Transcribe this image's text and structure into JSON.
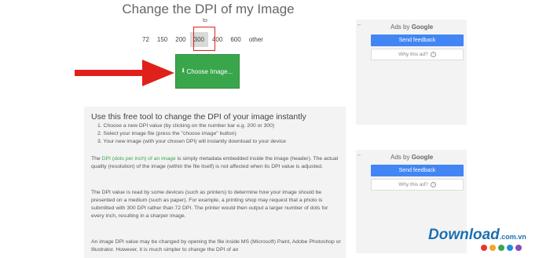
{
  "page": {
    "title": "Change the DPI of my Image",
    "to_label": "to"
  },
  "dpi_options": [
    "72",
    "150",
    "200",
    "300",
    "400",
    "600",
    "other"
  ],
  "selected_dpi": "300",
  "choose_button": {
    "label": "Choose Image..."
  },
  "content": {
    "heading": "Use this free tool to change the DPI of your image instantly",
    "steps": [
      "1. Choose a new DPI value (by clicking on the number bar e.g. 200 or 300)",
      "2. Select your image file (press the \"choose image\" button)",
      "3. Your new image (with your chosen DPI) will instantly download to your device"
    ],
    "p1_link": "DPI (dots per inch) of an image",
    "p1_rest": " is simply metadata embedded inside the image (header). The actual quality (resolution) of the image (within the file itself) is not affected when its DPI value is adjusted.",
    "p2": "The DPI value is read by some devices (such as printers) to determine how your image should be presented on a medium (such as paper). For example, a printing shop may request that a photo is submitted with 300 DPI rather than 72 DPI. The printer would then output a larger number of dots for every inch, resulting in a sharper image.",
    "p3": "An image DPI value may be changed by opening the file inside MS (Microsoft) Paint, Adobe Photoshop or Illustrator. However, it is much simpler to change the DPI of an"
  },
  "ads": {
    "header_prefix": "Ads by ",
    "header_brand": "Google",
    "feedback_label": "Send feedback",
    "why_label": "Why this ad?",
    "back_glyph": "←",
    "info_glyph": "i"
  },
  "watermark": {
    "text": "Download",
    "suffix": ".com.vn",
    "dot_colors": [
      "#e8362a",
      "#f6a623",
      "#3aa64c",
      "#1d8fd8",
      "#8a4bb6"
    ]
  },
  "colors": {
    "accent_green": "#3aa64c",
    "highlight_red": "#e0201b",
    "google_blue": "#4285f4"
  }
}
